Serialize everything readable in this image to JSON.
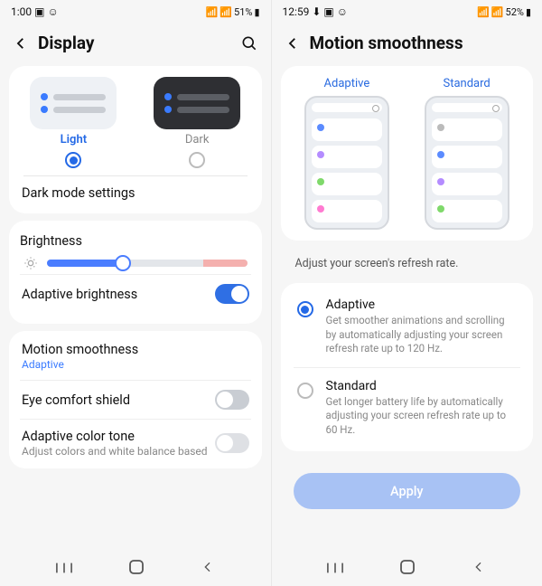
{
  "left": {
    "status": {
      "time": "1:00",
      "battery": "51%"
    },
    "title": "Display",
    "themes": {
      "light": "Light",
      "dark": "Dark",
      "selected": "light"
    },
    "dark_mode_settings": "Dark mode settings",
    "brightness_label": "Brightness",
    "adaptive_brightness": "Adaptive brightness",
    "motion_smoothness": {
      "label": "Motion smoothness",
      "value": "Adaptive"
    },
    "eye_comfort": "Eye comfort shield",
    "adaptive_color": {
      "label": "Adaptive color tone",
      "sub": "Adjust colors and white balance based"
    }
  },
  "right": {
    "status": {
      "time": "12:59",
      "battery": "52%"
    },
    "title": "Motion smoothness",
    "preview": {
      "adaptive": "Adaptive",
      "standard": "Standard"
    },
    "desc": "Adjust your screen's refresh rate.",
    "options": {
      "adaptive": {
        "title": "Adaptive",
        "desc": "Get smoother animations and scrolling by automatically adjusting your screen refresh rate up to 120 Hz."
      },
      "standard": {
        "title": "Standard",
        "desc": "Get longer battery life by automatically adjusting your screen refresh rate up to 60 Hz."
      }
    },
    "apply": "Apply"
  }
}
